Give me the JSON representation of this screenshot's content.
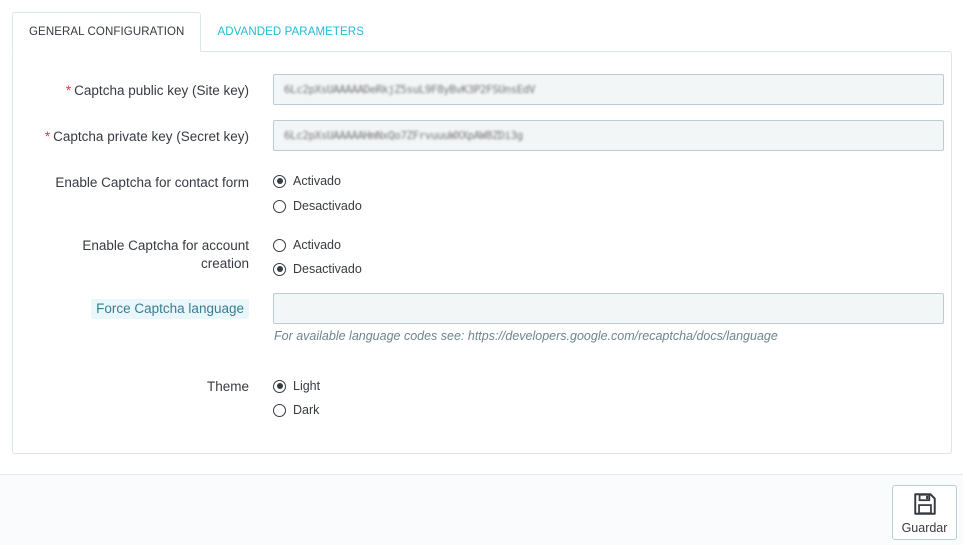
{
  "tabs": [
    {
      "label": "General configuration",
      "active": true
    },
    {
      "label": "Advanded parameters",
      "active": false
    }
  ],
  "form": {
    "public_key": {
      "required_mark": "*",
      "label": "Captcha public key (Site key)",
      "value": "6Lc2pXsUAAAAADeRkjZ5suL9F8yBvK3P2FSUnsEdV"
    },
    "private_key": {
      "required_mark": "*",
      "label": "Captcha private key (Secret key)",
      "value": "6Lc2pXsUAAAAAHmNxQo7ZFrvuuuWXXpAW8ZDi3g"
    },
    "contact_form": {
      "label": "Enable Captcha for contact form",
      "options": [
        {
          "label": "Activado",
          "checked": true
        },
        {
          "label": "Desactivado",
          "checked": false
        }
      ]
    },
    "account_creation": {
      "label_line1": "Enable Captcha for account",
      "label_line2": "creation",
      "options": [
        {
          "label": "Activado",
          "checked": false
        },
        {
          "label": "Desactivado",
          "checked": true
        }
      ]
    },
    "force_language": {
      "label": "Force Captcha language",
      "value": "",
      "help": "For available language codes see: https://developers.google.com/recaptcha/docs/language"
    },
    "theme": {
      "label": "Theme",
      "options": [
        {
          "label": "Light",
          "checked": true
        },
        {
          "label": "Dark",
          "checked": false
        }
      ]
    }
  },
  "footer": {
    "save_label": "Guardar",
    "save_icon": "floppy-disk-icon"
  }
}
